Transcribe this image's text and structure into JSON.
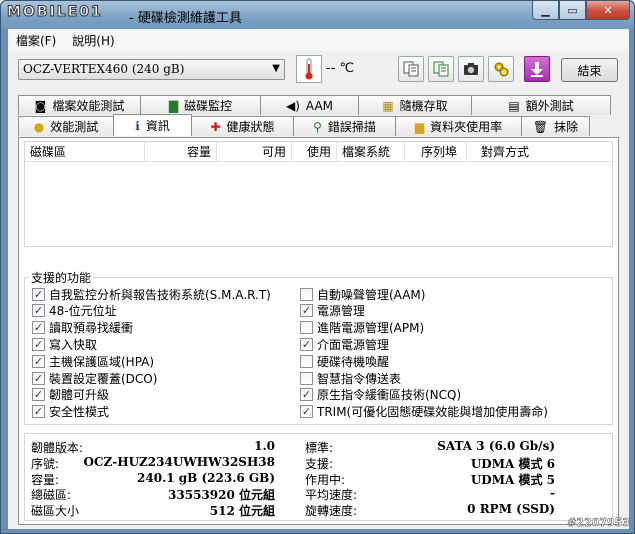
{
  "window": {
    "logo": "MOBILE01",
    "title": "- 硬碟檢測維護工具"
  },
  "menu": [
    "檔案(F)",
    "說明(H)"
  ],
  "toolbar": {
    "disk": "OCZ-VERTEX460 (240 gB)",
    "temperature": "-- ℃",
    "exit_label": "結束"
  },
  "tabs_top": [
    {
      "label": "檔案效能測試",
      "icon": "file-benchmark-icon"
    },
    {
      "label": "磁碟監控",
      "icon": "disk-monitor-icon"
    },
    {
      "label": "AAM",
      "icon": "speaker-icon"
    },
    {
      "label": "隨機存取",
      "icon": "random-access-icon"
    },
    {
      "label": "額外測試",
      "icon": "extra-tests-icon"
    }
  ],
  "tabs_bottom": [
    {
      "label": "效能測試",
      "icon": "lightbulb-icon"
    },
    {
      "label": "資訊",
      "icon": "info-icon",
      "active": true
    },
    {
      "label": "健康狀態",
      "icon": "health-cross-icon"
    },
    {
      "label": "錯誤掃描",
      "icon": "magnifier-icon"
    },
    {
      "label": "資料夾使用率",
      "icon": "folder-icon"
    },
    {
      "label": "抹除",
      "icon": "trash-icon"
    }
  ],
  "partition_table": {
    "columns": [
      "磁碟區",
      "容量",
      "可用",
      "使用",
      "檔案系統",
      "序列埠",
      "對齊方式"
    ]
  },
  "features": {
    "title": "支援的功能",
    "left": [
      {
        "label": "自我監控分析與報告技術系統(S.M.A.R.T)",
        "checked": true
      },
      {
        "label": "48-位元位址",
        "checked": true
      },
      {
        "label": "讀取預尋找緩衝",
        "checked": true
      },
      {
        "label": "寫入快取",
        "checked": true
      },
      {
        "label": "主機保護區域(HPA)",
        "checked": true
      },
      {
        "label": "裝置設定覆蓋(DCO)",
        "checked": true
      },
      {
        "label": "韌體可升級",
        "checked": true
      },
      {
        "label": "安全性模式",
        "checked": true
      }
    ],
    "right": [
      {
        "label": "自動噪聲管理(AAM)",
        "checked": false
      },
      {
        "label": "電源管理",
        "checked": true
      },
      {
        "label": "進階電源管理(APM)",
        "checked": false
      },
      {
        "label": "介面電源管理",
        "checked": true
      },
      {
        "label": "硬碟待機喚醒",
        "checked": false
      },
      {
        "label": "智慧指令傳送表",
        "checked": false
      },
      {
        "label": "原生指令緩衝區技術(NCQ)",
        "checked": true
      },
      {
        "label": "TRIM(可優化固態硬碟效能與增加使用壽命)",
        "checked": true
      }
    ]
  },
  "details": {
    "left": [
      {
        "label": "韌體版本:",
        "value": "1.0"
      },
      {
        "label": "序號:",
        "value": "OCZ-HUZ234UWHW32SH38"
      },
      {
        "label": "容量:",
        "value": "240.1 gB (223.6 GB)"
      },
      {
        "label": "總磁區:",
        "value": "33553920 位元組"
      },
      {
        "label": "磁區大小",
        "value": "512 位元組"
      }
    ],
    "right": [
      {
        "label": "標準:",
        "value": "SATA 3 (6.0 Gb/s)"
      },
      {
        "label": "支援:",
        "value": "UDMA 模式 6"
      },
      {
        "label": "作用中:",
        "value": "UDMA 模式 5"
      },
      {
        "label": "平均速度:",
        "value": "-"
      },
      {
        "label": "旋轉速度:",
        "value": "0 RPM (SSD)"
      }
    ]
  },
  "watermark": "#2207953"
}
